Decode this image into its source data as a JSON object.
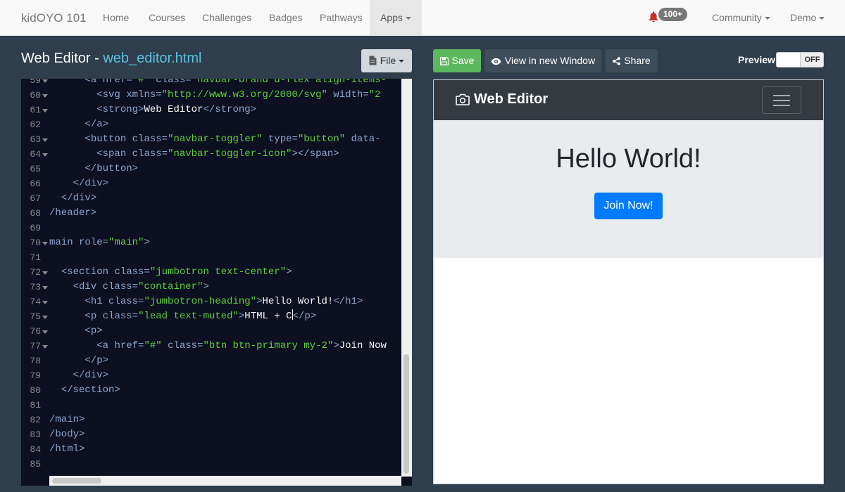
{
  "topnav": {
    "brand": "kidOYO 101",
    "links": [
      "Home",
      "Courses",
      "Challenges",
      "Badges",
      "Pathways"
    ],
    "active_link": "Apps",
    "notification_count": "100+",
    "community": "Community",
    "user": "Demo"
  },
  "editor": {
    "title_prefix": "Web Editor - ",
    "filename": "web_editor.html",
    "file_button": "File",
    "lines": [
      {
        "n": "59",
        "fold": true
      },
      {
        "n": "60",
        "fold": true
      },
      {
        "n": "61",
        "fold": true
      },
      {
        "n": "62",
        "fold": false
      },
      {
        "n": "63",
        "fold": true
      },
      {
        "n": "64",
        "fold": true
      },
      {
        "n": "65",
        "fold": false
      },
      {
        "n": "66",
        "fold": false
      },
      {
        "n": "67",
        "fold": false
      },
      {
        "n": "68",
        "fold": false
      },
      {
        "n": "69",
        "fold": false
      },
      {
        "n": "70",
        "fold": true
      },
      {
        "n": "71",
        "fold": false
      },
      {
        "n": "72",
        "fold": true
      },
      {
        "n": "73",
        "fold": true
      },
      {
        "n": "74",
        "fold": true
      },
      {
        "n": "75",
        "fold": true
      },
      {
        "n": "76",
        "fold": true
      },
      {
        "n": "77",
        "fold": true
      },
      {
        "n": "78",
        "fold": false
      },
      {
        "n": "79",
        "fold": false
      },
      {
        "n": "80",
        "fold": false
      },
      {
        "n": "81",
        "fold": false
      },
      {
        "n": "82",
        "fold": false
      },
      {
        "n": "83",
        "fold": false
      },
      {
        "n": "84",
        "fold": false
      },
      {
        "n": "85",
        "fold": false
      }
    ],
    "code": {
      "l59": {
        "indent": "      ",
        "open": "<a ",
        "attr1": "href=",
        "val1": "\"#\"",
        "attr2": " class=",
        "val2": "\"navbar-brand d-flex align-items-"
      },
      "l60": {
        "indent": "        ",
        "open": "<svg ",
        "attr1": "xmlns=",
        "val1": "\"http://www.w3.org/2000/svg\"",
        "attr2": " width=",
        "val2": "\"2"
      },
      "l61": {
        "indent": "        ",
        "open": "<strong>",
        "text": "Web Editor",
        "close": "</strong>"
      },
      "l62": {
        "indent": "      ",
        "close": "</a>"
      },
      "l63": {
        "indent": "      ",
        "open": "<button ",
        "attr1": "class=",
        "val1": "\"navbar-toggler\"",
        "attr2": " type=",
        "val2": "\"button\"",
        "attr3": " data-"
      },
      "l64": {
        "indent": "        ",
        "open": "<span ",
        "attr1": "class=",
        "val1": "\"navbar-toggler-icon\"",
        "close": "></span>"
      },
      "l65": {
        "indent": "      ",
        "close": "</button>"
      },
      "l66": {
        "indent": "    ",
        "close": "</div>"
      },
      "l67": {
        "indent": "  ",
        "close": "</div>"
      },
      "l68": {
        "indent": "",
        "close": "/header>"
      },
      "l70": {
        "indent": "",
        "open": "main ",
        "attr1": "role=",
        "val1": "\"main\"",
        "close": ">"
      },
      "l72": {
        "indent": "  ",
        "open": "<section ",
        "attr1": "class=",
        "val1": "\"jumbotron text-center\"",
        "close": ">"
      },
      "l73": {
        "indent": "    ",
        "open": "<div ",
        "attr1": "class=",
        "val1": "\"container\"",
        "close": ">"
      },
      "l74": {
        "indent": "      ",
        "open": "<h1 ",
        "attr1": "class=",
        "val1": "\"jumbotron-heading\"",
        "mid": ">",
        "text": "Hello World!",
        "close": "</h1>"
      },
      "l75": {
        "indent": "      ",
        "open": "<p ",
        "attr1": "class=",
        "val1": "\"lead text-muted\"",
        "mid": ">",
        "text": "HTML + C",
        "close": "</p>"
      },
      "l76": {
        "indent": "      ",
        "open": "<p>"
      },
      "l77": {
        "indent": "        ",
        "open": "<a ",
        "attr1": "href=",
        "val1": "\"#\"",
        "attr2": " class=",
        "val2": "\"btn btn-primary my-2\"",
        "mid": ">",
        "text": "Join Now"
      },
      "l78": {
        "indent": "      ",
        "close": "</p>"
      },
      "l79": {
        "indent": "    ",
        "close": "</div>"
      },
      "l80": {
        "indent": "  ",
        "close": "</section>"
      },
      "l82": {
        "indent": "",
        "close": "/main>"
      },
      "l83": {
        "indent": "",
        "close": "/body>"
      },
      "l84": {
        "indent": "",
        "close": "/html>"
      }
    }
  },
  "toolbar": {
    "save": "Save",
    "view_window": "View in new Window",
    "share": "Share",
    "preview_label": "Preview",
    "preview_toggle": "OFF"
  },
  "preview": {
    "brand": "Web Editor",
    "heading": "Hello World!",
    "button": "Join Now!"
  },
  "colors": {
    "page_bg": "#2e3e4c",
    "editor_bg": "#0c1021",
    "tag": "#8da6ce",
    "string": "#61ce3c",
    "save_green": "#5cb85c",
    "primary_blue": "#007bff",
    "filename": "#5bc0de"
  }
}
